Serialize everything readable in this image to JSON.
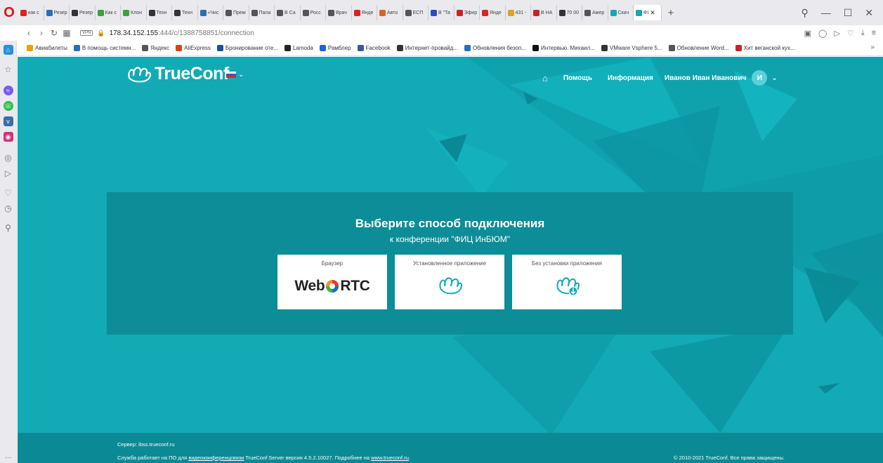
{
  "browser": {
    "tabs": [
      {
        "label": "как с",
        "color": "#e02020"
      },
      {
        "label": "Резер",
        "color": "#2a6ebb"
      },
      {
        "label": "Резер",
        "color": "#333333"
      },
      {
        "label": "Как с",
        "color": "#3ba33b"
      },
      {
        "label": "Клон",
        "color": "#3ba33b"
      },
      {
        "label": "Техн",
        "color": "#333333"
      },
      {
        "label": "Техн",
        "color": "#333333"
      },
      {
        "label": "«Чис",
        "color": "#2a6ebb"
      },
      {
        "label": "Прем",
        "color": "#555555"
      },
      {
        "label": "Пала",
        "color": "#555555"
      },
      {
        "label": "В Са",
        "color": "#555555"
      },
      {
        "label": "Росс",
        "color": "#555555"
      },
      {
        "label": "Врач",
        "color": "#555555"
      },
      {
        "label": "Янде",
        "color": "#e02020"
      },
      {
        "label": "Авто",
        "color": "#e06020"
      },
      {
        "label": "ЕСП",
        "color": "#555555"
      },
      {
        "label": "В \"Та",
        "color": "#2a4ebb"
      },
      {
        "label": "Эфир",
        "color": "#d02020"
      },
      {
        "label": "Янде",
        "color": "#e02020"
      },
      {
        "label": "431 -",
        "color": "#e0a020"
      },
      {
        "label": "В НА",
        "color": "#cc2222"
      },
      {
        "label": "70 00",
        "color": "#333333"
      },
      {
        "label": "Амер",
        "color": "#555555"
      },
      {
        "label": "Скач",
        "color": "#11aab5"
      },
      {
        "label": "ФІ",
        "color": "#11aab5"
      }
    ],
    "new_tab": "+",
    "url_host": "178.34.152.155",
    "url_rest": ":444/c/1388758851/connection",
    "vpn": "VPN",
    "bookmarks": [
      {
        "label": "Авиабилеты",
        "color": "#f0a000"
      },
      {
        "label": "В помощь системн...",
        "color": "#2a6ebb"
      },
      {
        "label": "Яндекс",
        "color": "#555555"
      },
      {
        "label": "AliExpress",
        "color": "#e04010"
      },
      {
        "label": "Бронирование оте...",
        "color": "#1a4fa0"
      },
      {
        "label": "Lamoda",
        "color": "#222222"
      },
      {
        "label": "Рамблер",
        "color": "#2060e0"
      },
      {
        "label": "Facebook",
        "color": "#3b5998"
      },
      {
        "label": "Интернет-провайд...",
        "color": "#333333"
      },
      {
        "label": "Обновления безоп...",
        "color": "#2a6ebb"
      },
      {
        "label": "Интервью. Михаил...",
        "color": "#111111"
      },
      {
        "label": "VMware Vsphere 5...",
        "color": "#333333"
      },
      {
        "label": "Обновление Word...",
        "color": "#555555"
      },
      {
        "label": "Хит веганской кух...",
        "color": "#cc2222"
      }
    ],
    "bookmarks_more": "»"
  },
  "header": {
    "logo_text": "TrueConf",
    "nav": {
      "help": "Помощь",
      "info": "Информация",
      "user_name": "Иванов Иван Иванович",
      "avatar_letter": "И"
    }
  },
  "panel": {
    "title": "Выберите способ подключения",
    "subtitle": "к конференции \"ФИЦ ИнБЮМ\"",
    "cards": [
      {
        "label": "Браузер",
        "logo_left": "Web",
        "logo_right": "RTC"
      },
      {
        "label": "Установленное приложение"
      },
      {
        "label": "Без установки приложения"
      }
    ]
  },
  "footer": {
    "server": "Сервер: ibss.trueconf.ru",
    "service_pre": "Служба работает на ПО для ",
    "service_link1": "видеоконференцсвязи",
    "service_mid": " TrueConf Server версия 4.5.2.10027. Подробнее на ",
    "service_link2": "www.trueconf.ru",
    "service_end": ".",
    "copyright": "© 2010-2021 TrueConf. Все права защищены."
  },
  "colors": {
    "page_bg": "#11aab5",
    "panel_bg": "#0c8d98",
    "avatar": "#5ad0d8"
  }
}
